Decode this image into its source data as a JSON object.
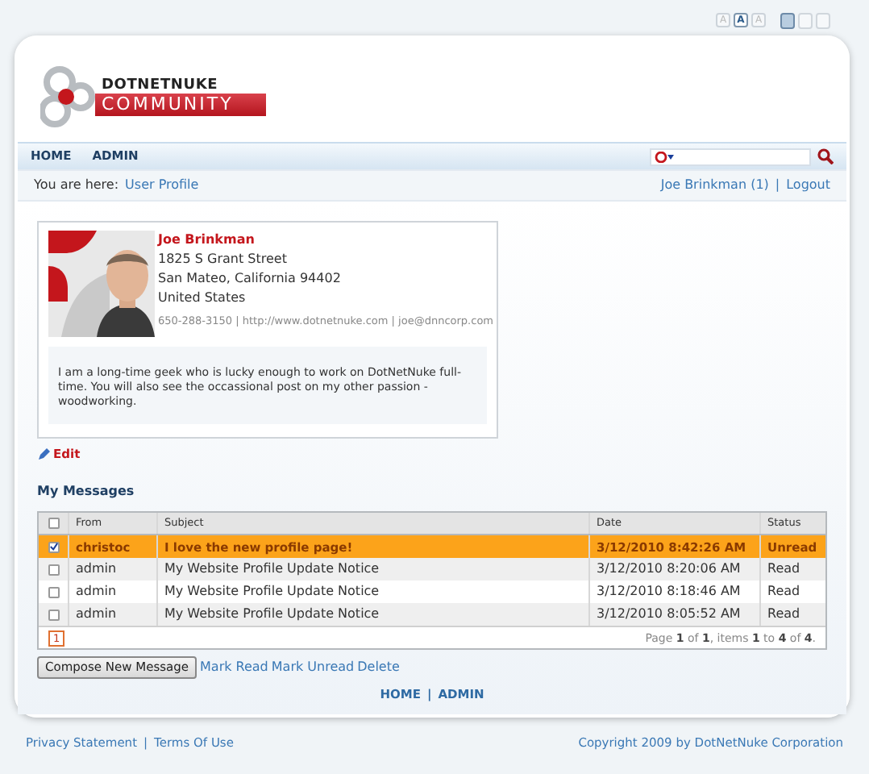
{
  "font_size_buttons": [
    {
      "label": "A",
      "selected": false
    },
    {
      "label": "A",
      "selected": true
    },
    {
      "label": "A",
      "selected": false
    }
  ],
  "layout_buttons": [
    {
      "selected": true
    },
    {
      "selected": false
    },
    {
      "selected": false
    }
  ],
  "logo": {
    "top": "DOTNETNUKE",
    "bottom": "COMMUNITY"
  },
  "nav": [
    "HOME",
    "ADMIN"
  ],
  "breadcrumb": {
    "label": "You are here:",
    "current": "User Profile"
  },
  "user_links": {
    "items": [
      "Joe Brinkman (1)",
      "Logout"
    ],
    "separator": "|"
  },
  "profile": {
    "name": "Joe Brinkman",
    "address": [
      "1825 S Grant Street",
      "San Mateo, California 94402",
      "United States"
    ],
    "contact": "650-288-3150 | http://www.dotnetnuke.com | joe@dnncorp.com",
    "bio": "I am a long-time geek who is lucky enough to work on DotNetNuke full-time. You will also see the occassional post on my other passion - woodworking."
  },
  "edit": "Edit",
  "messages": {
    "title": "My Messages",
    "header_checked": false,
    "columns": [
      "From",
      "Subject",
      "Date",
      "Status"
    ],
    "rows": [
      {
        "from": "christoc",
        "subject": "I love the new profile page!",
        "date": "3/12/2010 8:42:26 AM",
        "status": "Unread",
        "checked": true,
        "selected": true
      },
      {
        "from": "admin",
        "subject": "My Website Profile Update Notice",
        "date": "3/12/2010 8:20:06 AM",
        "status": "Read",
        "checked": false,
        "selected": false
      },
      {
        "from": "admin",
        "subject": "My Website Profile Update Notice",
        "date": "3/12/2010 8:18:46 AM",
        "status": "Read",
        "checked": false,
        "selected": false
      },
      {
        "from": "admin",
        "subject": "My Website Profile Update Notice",
        "date": "3/12/2010 8:05:52 AM",
        "status": "Read",
        "checked": false,
        "selected": false
      }
    ],
    "pages": [
      {
        "label": "1",
        "selected": true
      }
    ],
    "summary": "Page **1** of **1**, items **1** to **4** of **4**."
  },
  "compose_button": "Compose New Message",
  "actions": [
    "Mark Read",
    "Mark Unread",
    "Delete"
  ],
  "footer_nav": {
    "items": [
      "HOME",
      "ADMIN"
    ],
    "separator": "|"
  },
  "bottom_links": {
    "items": [
      "Privacy Statement",
      "Terms Of Use"
    ],
    "separator": "|"
  },
  "copyright": "Copyright 2009 by DotNetNuke Corporation"
}
